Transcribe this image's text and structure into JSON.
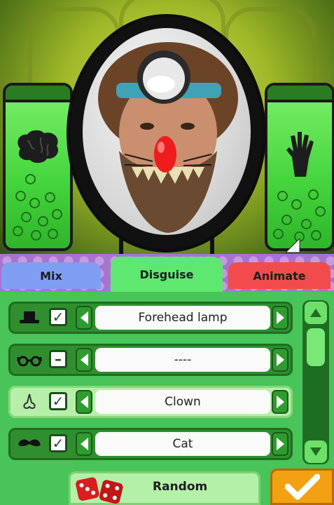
{
  "tabs": [
    {
      "label": "Mix",
      "color": "#7f9ef2"
    },
    {
      "label": "Disguise",
      "color": "#5ee870",
      "active": true
    },
    {
      "label": "Animate",
      "color": "#f14b4b"
    }
  ],
  "rows": [
    {
      "icon": "hat-icon",
      "check": "✓",
      "value": "Forehead lamp",
      "selected": false
    },
    {
      "icon": "glasses-icon",
      "check": "–",
      "value": "----",
      "selected": false
    },
    {
      "icon": "nose-icon",
      "check": "✓",
      "value": "Clown",
      "selected": true
    },
    {
      "icon": "mustache-icon",
      "check": "✓",
      "value": "Cat",
      "selected": false
    }
  ],
  "footer": {
    "random_label": "Random"
  },
  "colors": {
    "panel": "#48c458",
    "accent": "#f3a012",
    "tab_band": "#a873cf"
  }
}
